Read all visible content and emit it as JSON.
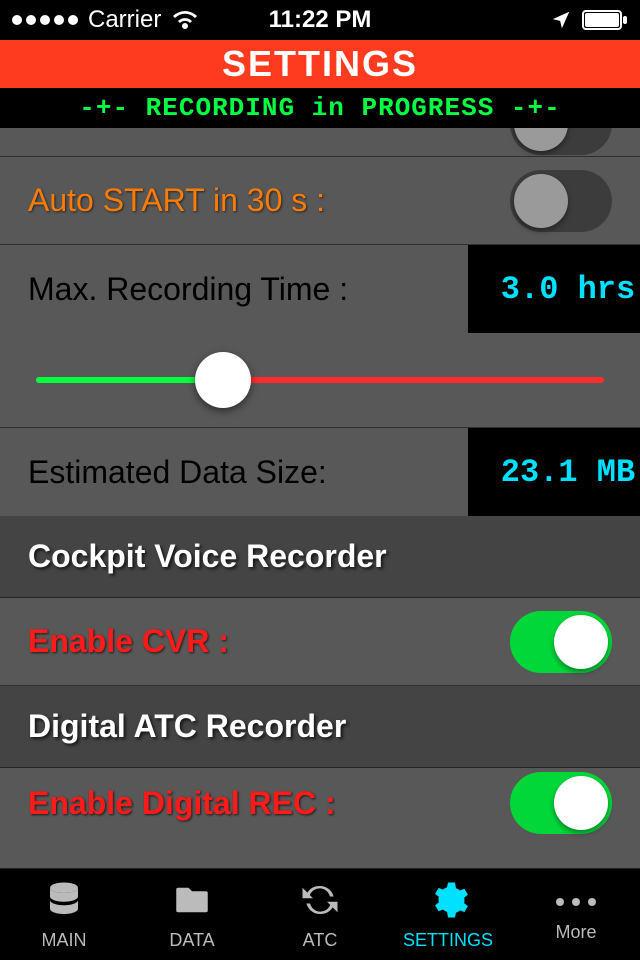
{
  "status": {
    "carrier": "Carrier",
    "time": "11:22 PM"
  },
  "header": {
    "title": "SETTINGS"
  },
  "banner": {
    "text": "-+- RECORDING in PROGRESS -+-"
  },
  "settings": {
    "auto_start_label": "Auto START in 30 s :",
    "auto_start_on": false,
    "max_rec_label": "Max. Recording Time :",
    "max_rec_value": "3.0 hrs",
    "slider_percent": 33,
    "est_size_label": "Estimated Data Size:",
    "est_size_value": "23.1 MB",
    "section_cvr": "Cockpit Voice Recorder",
    "enable_cvr_label": "Enable CVR :",
    "enable_cvr_on": true,
    "section_atc": "Digital ATC Recorder",
    "enable_digital_label": "Enable Digital REC :",
    "enable_digital_on": true
  },
  "tabs": {
    "main": "MAIN",
    "data": "DATA",
    "atc": "ATC",
    "settings": "SETTINGS",
    "more": "More"
  }
}
